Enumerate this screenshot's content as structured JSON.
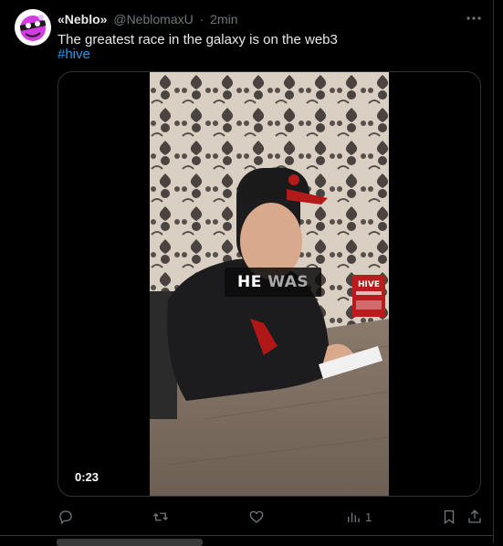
{
  "post": {
    "display_name": "«Neblo»",
    "handle": "@NeblomaxU",
    "separator": "·",
    "time": "2min",
    "text": "The greatest race in the galaxy is on the web3",
    "hashtag": "#hive"
  },
  "media": {
    "caption_word1": "HE",
    "caption_word2": "WAS",
    "duration": "0:23",
    "sign_text": "HIVE"
  },
  "actions": {
    "reply": {
      "icon": "reply-icon",
      "count": ""
    },
    "repost": {
      "icon": "repost-icon",
      "count": ""
    },
    "like": {
      "icon": "like-icon",
      "count": ""
    },
    "views": {
      "icon": "views-icon",
      "count": "1"
    },
    "bookmark": {
      "icon": "bookmark-icon"
    },
    "share": {
      "icon": "share-icon"
    }
  },
  "colors": {
    "background": "#000000",
    "text": "#e7e9ea",
    "muted": "#71767b",
    "link": "#1d9bf0",
    "border": "#2f3336",
    "avatar_accent": "#d23ce0"
  }
}
